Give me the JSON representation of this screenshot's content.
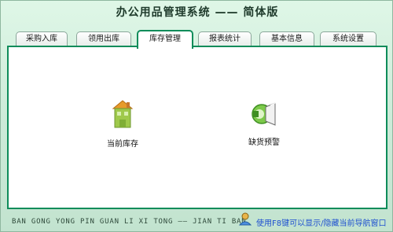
{
  "app": {
    "title": "办公用品管理系统 —— 简体版"
  },
  "tabs": [
    {
      "label": "采购入库"
    },
    {
      "label": "领用出库"
    },
    {
      "label": "库存管理",
      "active": true
    },
    {
      "label": "报表统计"
    },
    {
      "label": "基本信息"
    },
    {
      "label": "系统设置"
    }
  ],
  "modules": {
    "inventory": {
      "label": "当前库存",
      "icon": "building-icon"
    },
    "alert": {
      "label": "缺货预警",
      "icon": "megaphone-icon"
    }
  },
  "footer": {
    "pinyin": "BAN GONG YONG PIN GUAN LI XI TONG —— JIAN TI BAN",
    "hint": "使用F8键可以显示/隐藏当前导航窗口",
    "hint_icon": "user-icon"
  },
  "colors": {
    "accent": "#0e8c5a",
    "background": "#cdebd9",
    "hint_text": "#1d4fd0"
  }
}
